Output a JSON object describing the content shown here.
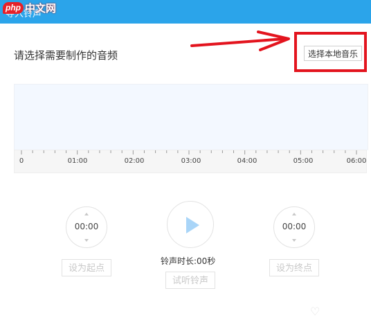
{
  "window": {
    "title": "导入铃声"
  },
  "watermark": {
    "badge": "php",
    "text": "中文网"
  },
  "main": {
    "prompt": "请选择需要制作的音频",
    "select_button": "选择本地音乐"
  },
  "timeline": {
    "labels": [
      "0",
      "01:00",
      "02:00",
      "03:00",
      "04:00",
      "05:00",
      "06:00"
    ]
  },
  "controls": {
    "start_time": "00:00",
    "end_time": "00:00",
    "set_start_label": "设为起点",
    "set_end_label": "设为终点",
    "duration_text": "铃声时长:00秒",
    "preview_label": "试听铃声"
  },
  "colors": {
    "titlebar": "#2ba4ea",
    "highlight": "#e3141e",
    "play_icon": "#a9d5f8"
  },
  "icons": [
    "up-arrow-icon",
    "down-arrow-icon",
    "play-icon",
    "heart-icon",
    "red-arrow-icon"
  ]
}
